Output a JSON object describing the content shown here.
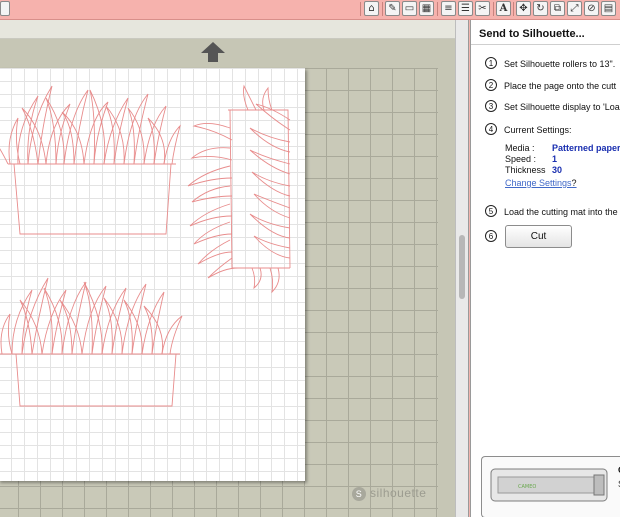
{
  "toolbar": {
    "left_icon": "square-icon",
    "icons": [
      "home-icon",
      "pencil-icon",
      "window-icon",
      "grid-icon",
      "align-icon",
      "lines-icon",
      "scissors-icon",
      "text-icon",
      "nodes-icon",
      "rotate-icon",
      "replicate-icon",
      "transform-icon",
      "cut-settings-icon",
      "send-icon"
    ],
    "text_glyph": "A"
  },
  "workspace": {
    "watermark": "silhouette"
  },
  "panel": {
    "title": "Send to Silhouette...",
    "steps": [
      {
        "num": "1",
        "text": "Set Silhouette rollers to 13\"."
      },
      {
        "num": "2",
        "text": "Place the page onto the cutt"
      },
      {
        "num": "3",
        "text": "Set Silhouette display to 'Loa"
      },
      {
        "num": "4",
        "text": "Current Settings:"
      },
      {
        "num": "5",
        "text": "Load the cutting mat into the"
      },
      {
        "num": "6",
        "text": ""
      }
    ],
    "settings": {
      "media_label": "Media :",
      "media_value": "Patterned paper",
      "speed_label": "Speed :",
      "speed_value": "1",
      "thickness_label": "Thickness",
      "thickness_value": "30"
    },
    "change_settings": "Change Settings",
    "change_settings_suffix": "?",
    "cut_button": "Cut",
    "device": {
      "name": "C",
      "sub": "S",
      "brand": "CAMEO"
    }
  }
}
